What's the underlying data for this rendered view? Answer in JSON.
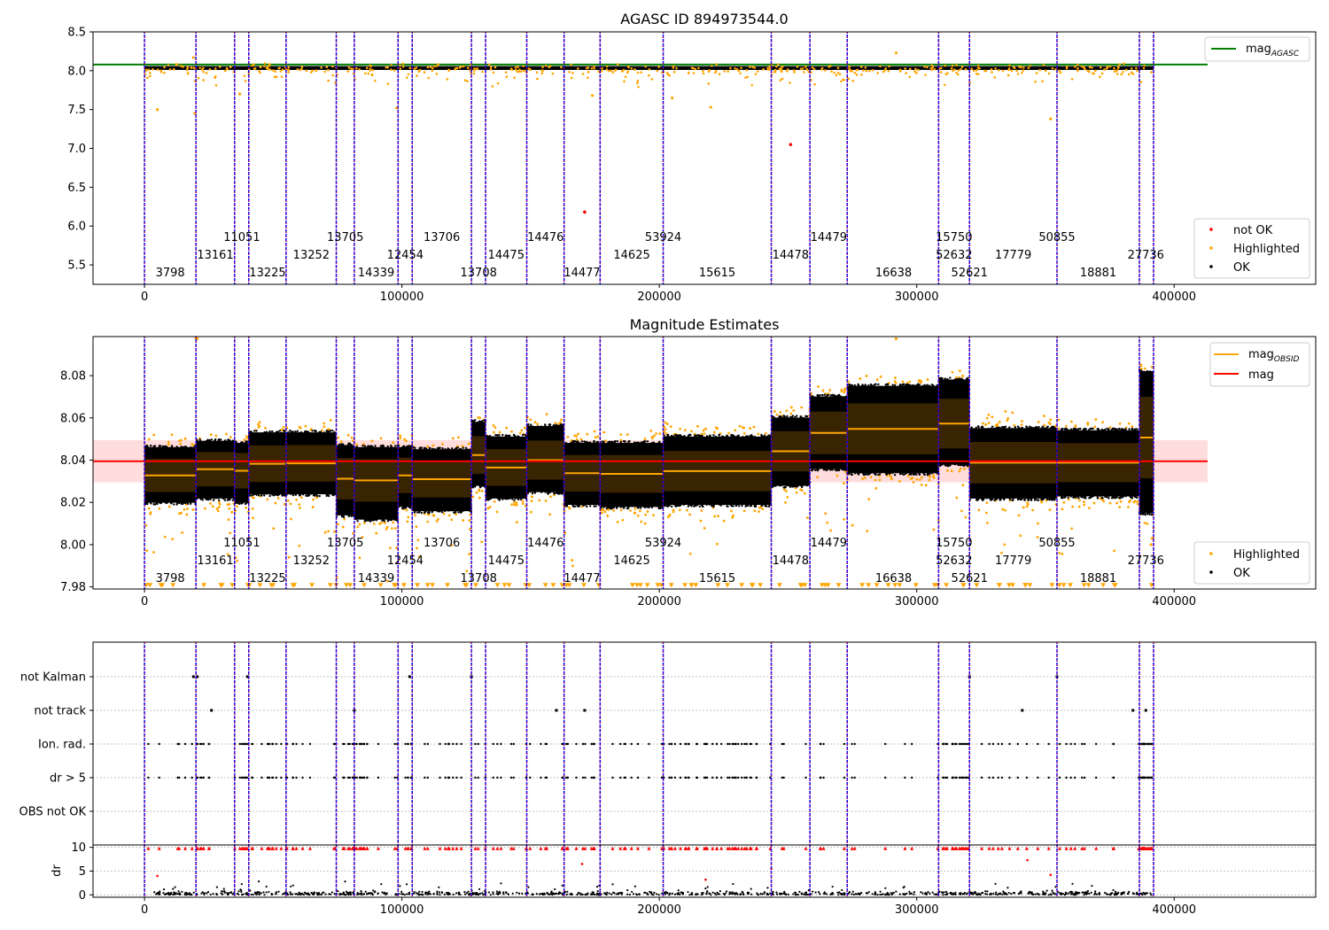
{
  "chart_data": [
    {
      "type": "scatter",
      "title": "AGASC ID 894973544.0",
      "xlim": [
        -20000,
        455000
      ],
      "ylim": [
        5.25,
        8.5
      ],
      "xticks": [
        0,
        100000,
        200000,
        300000,
        400000
      ],
      "xtick_labels": [
        "0",
        "100000",
        "200000",
        "300000",
        "400000"
      ],
      "yticks": [
        5.5,
        6.0,
        6.5,
        7.0,
        7.5,
        8.0,
        8.5
      ],
      "ytick_labels": [
        "5.5",
        "6.0",
        "6.5",
        "7.0",
        "7.5",
        "8.0",
        "8.5"
      ],
      "mag_agasc": 8.08,
      "ok_band": {
        "xrange": [
          0,
          392000
        ],
        "y": 8.035,
        "spread": 0.025
      },
      "highlighted_outliers": [
        {
          "x": 5000,
          "y": 7.5
        },
        {
          "x": 19000,
          "y": 8.17
        },
        {
          "x": 19500,
          "y": 7.45
        },
        {
          "x": 37000,
          "y": 7.7
        },
        {
          "x": 98000,
          "y": 7.52
        },
        {
          "x": 174000,
          "y": 7.68
        },
        {
          "x": 205000,
          "y": 7.65
        },
        {
          "x": 220000,
          "y": 7.53
        },
        {
          "x": 292000,
          "y": 8.23
        },
        {
          "x": 352000,
          "y": 7.38
        }
      ],
      "not_ok_points": [
        {
          "x": 251000,
          "y": 7.05
        },
        {
          "x": 171000,
          "y": 6.18
        }
      ],
      "legend_top": [
        "mag_AGASC"
      ],
      "legend_bottom": [
        "not OK",
        "Highlighted",
        "OK"
      ]
    },
    {
      "type": "scatter",
      "title": "Magnitude Estimates",
      "xlim": [
        -20000,
        455000
      ],
      "ylim": [
        7.979,
        8.0985
      ],
      "xticks": [
        0,
        100000,
        200000,
        300000,
        400000
      ],
      "xtick_labels": [
        "0",
        "100000",
        "200000",
        "300000",
        "400000"
      ],
      "yticks": [
        7.98,
        8.0,
        8.02,
        8.04,
        8.06,
        8.08
      ],
      "ytick_labels": [
        "7.98",
        "8.00",
        "8.02",
        "8.04",
        "8.06",
        "8.08"
      ],
      "mag": 8.0395,
      "mag_band": [
        8.0295,
        8.0495
      ],
      "obsid_segments": [
        {
          "x0": 0,
          "x1": 20000,
          "mean": 8.0328,
          "lo": 8.019,
          "hi": 8.047
        },
        {
          "x0": 20000,
          "x1": 35000,
          "mean": 8.0357,
          "lo": 8.021,
          "hi": 8.05
        },
        {
          "x0": 35000,
          "x1": 40500,
          "mean": 8.035,
          "lo": 8.019,
          "hi": 8.049
        },
        {
          "x0": 40500,
          "x1": 55000,
          "mean": 8.0383,
          "lo": 8.023,
          "hi": 8.054
        },
        {
          "x0": 55000,
          "x1": 74500,
          "mean": 8.0385,
          "lo": 8.023,
          "hi": 8.054
        },
        {
          "x0": 74500,
          "x1": 81500,
          "mean": 8.0312,
          "lo": 8.013,
          "hi": 8.048
        },
        {
          "x0": 81500,
          "x1": 98500,
          "mean": 8.0304,
          "lo": 8.011,
          "hi": 8.047
        },
        {
          "x0": 98500,
          "x1": 104000,
          "mean": 8.0328,
          "lo": 8.017,
          "hi": 8.047
        },
        {
          "x0": 104000,
          "x1": 127000,
          "mean": 8.031,
          "lo": 8.015,
          "hi": 8.046
        },
        {
          "x0": 127000,
          "x1": 132500,
          "mean": 8.0424,
          "lo": 8.027,
          "hi": 8.059
        },
        {
          "x0": 132500,
          "x1": 148500,
          "mean": 8.0365,
          "lo": 8.021,
          "hi": 8.052
        },
        {
          "x0": 148500,
          "x1": 163000,
          "mean": 8.04,
          "lo": 8.024,
          "hi": 8.057
        },
        {
          "x0": 163000,
          "x1": 177000,
          "mean": 8.0338,
          "lo": 8.018,
          "hi": 8.049
        },
        {
          "x0": 177000,
          "x1": 201500,
          "mean": 8.0335,
          "lo": 8.017,
          "hi": 8.049
        },
        {
          "x0": 201500,
          "x1": 243500,
          "mean": 8.0348,
          "lo": 8.018,
          "hi": 8.052
        },
        {
          "x0": 243500,
          "x1": 258500,
          "mean": 8.0442,
          "lo": 8.027,
          "hi": 8.061
        },
        {
          "x0": 258500,
          "x1": 273000,
          "mean": 8.0529,
          "lo": 8.035,
          "hi": 8.071
        },
        {
          "x0": 273000,
          "x1": 308500,
          "mean": 8.0548,
          "lo": 8.033,
          "hi": 8.076
        },
        {
          "x0": 308500,
          "x1": 320500,
          "mean": 8.0573,
          "lo": 8.037,
          "hi": 8.079
        },
        {
          "x0": 320500,
          "x1": 354500,
          "mean": 8.0388,
          "lo": 8.021,
          "hi": 8.056
        },
        {
          "x0": 354500,
          "x1": 386500,
          "mean": 8.0388,
          "lo": 8.022,
          "hi": 8.055
        },
        {
          "x0": 386500,
          "x1": 392000,
          "mean": 8.0507,
          "lo": 8.014,
          "hi": 8.083
        }
      ],
      "legend_top": [
        "mag_OBSID",
        "mag"
      ],
      "legend_bottom": [
        "Highlighted",
        "OK"
      ]
    },
    {
      "type": "scatter",
      "title": "",
      "xlim": [
        -20000,
        455000
      ],
      "flag_rows": [
        "not Kalman",
        "not track",
        "Ion. rad.",
        "dr > 5",
        "OBS not OK"
      ],
      "dr_yticks": [
        0,
        5,
        10
      ],
      "dr_ytick_labels": [
        "0",
        "5",
        "10"
      ],
      "dr_ylim": [
        -0.5,
        10.5
      ],
      "ylabel": "dr",
      "xticks": [
        0,
        100000,
        200000,
        300000,
        400000
      ],
      "xtick_labels": [
        "0",
        "100000",
        "200000",
        "300000",
        "400000"
      ],
      "flag_points": {
        "not Kalman": [
          19000,
          20500,
          40000,
          103000,
          127000,
          320500,
          354500
        ],
        "not track": [
          26000,
          81500,
          160000,
          171000,
          341000,
          384000,
          389000
        ]
      }
    }
  ],
  "obsid_boundaries": [
    0,
    20000,
    35000,
    40500,
    55000,
    74500,
    81500,
    98500,
    104000,
    127000,
    132500,
    148500,
    163000,
    177000,
    201500,
    243500,
    258500,
    273000,
    308500,
    320500,
    354500,
    386500,
    392000
  ],
  "obsid_labels": [
    {
      "text": "3798",
      "x": 10000,
      "row": 3
    },
    {
      "text": "13161",
      "x": 27500,
      "row": 2
    },
    {
      "text": "11051",
      "x": 37800,
      "row": 1
    },
    {
      "text": "13225",
      "x": 47800,
      "row": 3
    },
    {
      "text": "13252",
      "x": 64800,
      "row": 2
    },
    {
      "text": "13705",
      "x": 78000,
      "row": 1
    },
    {
      "text": "14339",
      "x": 90000,
      "row": 3
    },
    {
      "text": "12454",
      "x": 101300,
      "row": 2
    },
    {
      "text": "13706",
      "x": 115500,
      "row": 1
    },
    {
      "text": "13708",
      "x": 129800,
      "row": 3
    },
    {
      "text": "14475",
      "x": 140500,
      "row": 2
    },
    {
      "text": "14476",
      "x": 155800,
      "row": 1
    },
    {
      "text": "14477",
      "x": 170000,
      "row": 3
    },
    {
      "text": "14625",
      "x": 189300,
      "row": 2
    },
    {
      "text": "53924",
      "x": 201500,
      "row": 1
    },
    {
      "text": "15615",
      "x": 222500,
      "row": 3
    },
    {
      "text": "14478",
      "x": 251000,
      "row": 2
    },
    {
      "text": "14479",
      "x": 265800,
      "row": 1
    },
    {
      "text": "16638",
      "x": 291000,
      "row": 3
    },
    {
      "text": "52632",
      "x": 314500,
      "row": 2
    },
    {
      "text": "15750",
      "x": 314500,
      "row": 1
    },
    {
      "text": "52621",
      "x": 320500,
      "row": 3
    },
    {
      "text": "17779",
      "x": 337500,
      "row": 2
    },
    {
      "text": "50855",
      "x": 354500,
      "row": 1
    },
    {
      "text": "18881",
      "x": 370500,
      "row": 3
    },
    {
      "text": "27736",
      "x": 389000,
      "row": 2
    }
  ],
  "legend": {
    "mag_agasc_main": "mag",
    "mag_agasc_sub": "AGASC",
    "mag_obsid_main": "mag",
    "mag_obsid_sub": "OBSID",
    "mag": "mag",
    "not_ok": "not OK",
    "highlighted": "Highlighted",
    "ok": "OK"
  },
  "colors": {
    "ok": "#000000",
    "highlighted": "#FFA500",
    "not_ok": "#FF0000",
    "mag_agasc": "#008000",
    "mag_obsid": "#FFA500",
    "mag": "#FF0000",
    "mag_band": "#FFB3B3",
    "obsid_line": "#800080",
    "obsid_line_alt": "#0000FF",
    "grid": "#B0B0B0"
  }
}
